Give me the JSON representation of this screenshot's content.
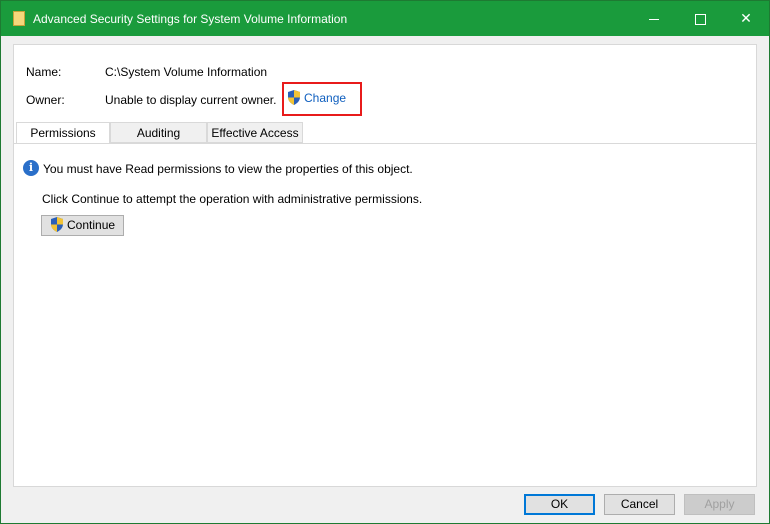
{
  "window": {
    "title": "Advanced Security Settings for System Volume Information",
    "controls": {
      "minimize": "–",
      "maximize": "□",
      "close": "✕"
    }
  },
  "name": {
    "label": "Name:",
    "value": "C:\\System Volume Information"
  },
  "owner": {
    "label": "Owner:",
    "value": "Unable to display current owner.",
    "change_link": "Change"
  },
  "tabs": [
    {
      "label": "Permissions",
      "active": true
    },
    {
      "label": "Auditing",
      "active": false
    },
    {
      "label": "Effective Access",
      "active": false
    }
  ],
  "permissions": {
    "info_icon": "i",
    "info_message": "You must have Read permissions to view the properties of this object.",
    "continue_message": "Click Continue to attempt the operation with administrative permissions.",
    "continue_label": "Continue"
  },
  "buttons": {
    "ok": "OK",
    "cancel": "Cancel",
    "apply": "Apply"
  },
  "colors": {
    "titlebar": "#1a9b3c",
    "link": "#0f5fbf",
    "highlight": "#e81b1b",
    "info_icon": "#2a6fc9",
    "default_button_border": "#0078d7"
  }
}
